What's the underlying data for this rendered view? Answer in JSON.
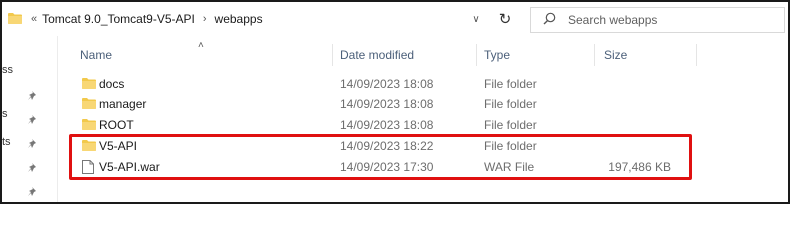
{
  "address": {
    "overflow_label": "«",
    "crumbs": [
      "Tomcat 9.0_Tomcat9-V5-API",
      "webapps"
    ],
    "separator": "›",
    "dropdown_icon": "chevron-down-icon",
    "refresh_icon": "refresh-icon"
  },
  "search": {
    "placeholder": "Search webapps",
    "icon": "search-icon"
  },
  "nav": {
    "partial_labels": [
      "ss",
      "s",
      "ts"
    ]
  },
  "columns": {
    "name": "Name",
    "date": "Date modified",
    "type": "Type",
    "size": "Size"
  },
  "rows": [
    {
      "name": "docs",
      "date": "14/09/2023 18:08",
      "type": "File folder",
      "size": "",
      "icon": "folder-icon"
    },
    {
      "name": "manager",
      "date": "14/09/2023 18:08",
      "type": "File folder",
      "size": "",
      "icon": "folder-icon"
    },
    {
      "name": "ROOT",
      "date": "14/09/2023 18:08",
      "type": "File folder",
      "size": "",
      "icon": "folder-icon"
    },
    {
      "name": "V5-API",
      "date": "14/09/2023 18:22",
      "type": "File folder",
      "size": "",
      "icon": "folder-icon"
    },
    {
      "name": "V5-API.war",
      "date": "14/09/2023 17:30",
      "type": "WAR File",
      "size": "197,486 KB",
      "icon": "file-icon"
    }
  ],
  "colors": {
    "folder": "#f2c94c",
    "highlight": "#e01010",
    "header_text": "#4c607a"
  }
}
